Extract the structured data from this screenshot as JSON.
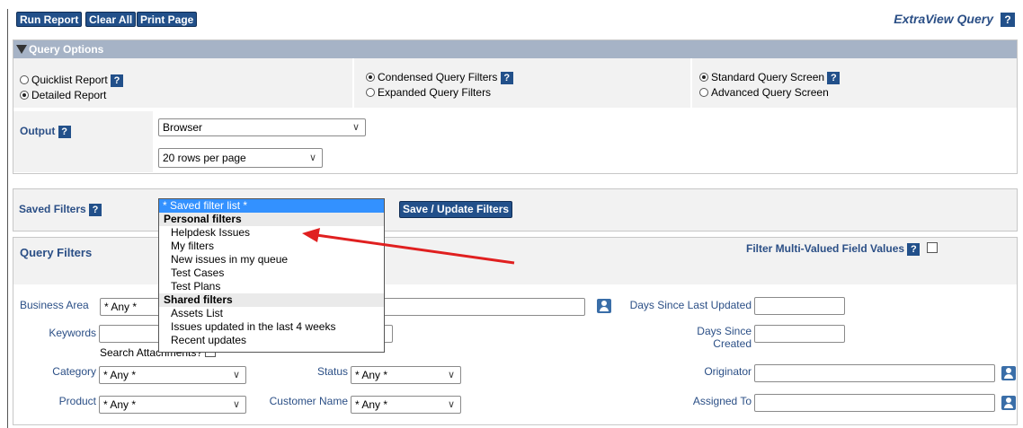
{
  "toolbar": {
    "run_report": "Run Report",
    "clear_all": "Clear All",
    "print_page": "Print Page"
  },
  "app_title": "ExtraView Query",
  "help_glyph": "?",
  "query_options": {
    "header": "Query Options",
    "report_types": [
      "Quicklist Report",
      "Detailed Report"
    ],
    "filter_modes": [
      "Condensed Query Filters",
      "Expanded Query Filters"
    ],
    "screen_modes": [
      "Standard Query Screen",
      "Advanced Query Screen"
    ],
    "output_label": "Output",
    "output_value": "Browser",
    "rows_value": "20 rows per page"
  },
  "saved_filters": {
    "label": "Saved Filters",
    "save_button": "Save / Update Filters",
    "dropdown": {
      "selected": "* Saved filter list *",
      "personal_header": "Personal filters",
      "personal": [
        "Helpdesk Issues",
        "My filters",
        "New issues in my queue",
        "Test Cases",
        "Test Plans"
      ],
      "shared_header": "Shared filters",
      "shared": [
        "Assets List",
        "Issues updated in the last 4 weeks",
        "Recent updates"
      ]
    }
  },
  "query_filters": {
    "title": "Query Filters",
    "multi_valued_label": "Filter Multi-Valued Field Values",
    "business_area_label": "Business Area",
    "business_area_value": "* Any *",
    "keywords_label": "Keywords",
    "search_attachments_label": "Search Attachments?",
    "days_last_updated_label": "Days Since Last Updated",
    "days_created_label": "Days Since Created",
    "category_label": "Category",
    "category_value": "* Any *",
    "status_label": "Status",
    "status_value": "* Any *",
    "originator_label": "Originator",
    "product_label": "Product",
    "product_value": "* Any *",
    "customer_name_label": "Customer Name",
    "customer_name_value": "* Any *",
    "assigned_to_label": "Assigned To"
  },
  "colors": {
    "button_blue": "#22508a",
    "header_gray": "#a6b3c6",
    "label_blue": "#2b4f86",
    "highlight": "#3391ff",
    "arrow_red": "#e02020"
  }
}
